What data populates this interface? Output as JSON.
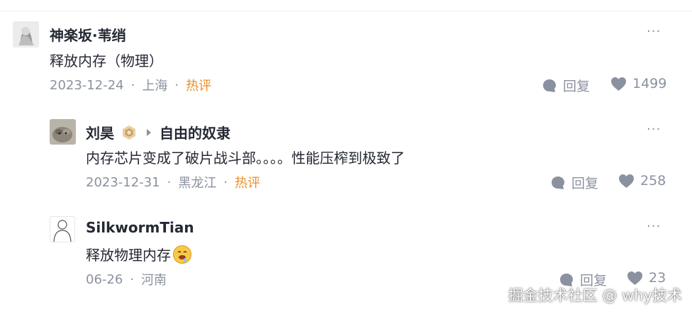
{
  "comments": [
    {
      "author": "神楽坂·苇绡",
      "content": "释放内存（物理）",
      "date": "2023-12-24",
      "location": "上海",
      "hot": "热评",
      "reply_label": "回复",
      "likes": "1499"
    },
    {
      "author": "刘昊",
      "reply_to": "自由的奴隶",
      "content": "内存芯片变成了破片战斗部。。。。性能压榨到极致了",
      "date": "2023-12-31",
      "location": "黑龙江",
      "hot": "热评",
      "reply_label": "回复",
      "likes": "258"
    },
    {
      "author": "SilkwormTian",
      "content": "释放物理内存",
      "date": "06-26",
      "location": "河南",
      "reply_label": "回复",
      "likes": "23"
    }
  ],
  "more_label": "···",
  "separator": "·",
  "watermark": "掘金技术社区 @ why技术",
  "colors": {
    "text": "#252933",
    "muted": "#8a919f",
    "hot": "#e88f27"
  }
}
